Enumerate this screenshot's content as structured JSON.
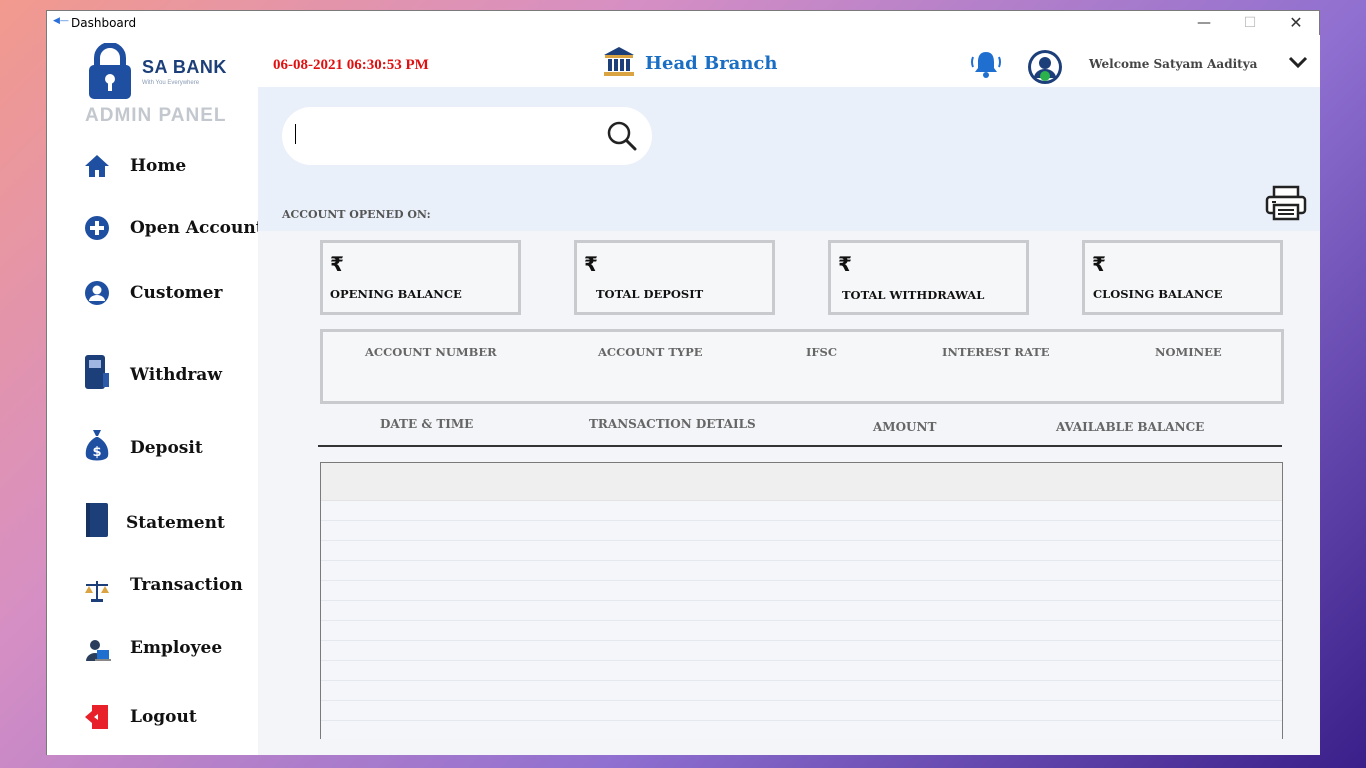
{
  "window": {
    "title": "Dashboard"
  },
  "sidebar": {
    "brand": "SA BANK",
    "tagline": "With You Everywhere",
    "panel_title": "ADMIN PANEL",
    "items": [
      {
        "label": "Home",
        "icon": "home-icon"
      },
      {
        "label": "Open Account",
        "icon": "plus-circle-icon"
      },
      {
        "label": "Customer",
        "icon": "user-circle-icon"
      },
      {
        "label": "Withdraw",
        "icon": "atm-icon"
      },
      {
        "label": "Deposit",
        "icon": "money-bag-icon"
      },
      {
        "label": "Statement",
        "icon": "notebook-icon"
      },
      {
        "label": "Transaction",
        "icon": "scale-icon"
      },
      {
        "label": "Employee",
        "icon": "employee-icon"
      },
      {
        "label": "Logout",
        "icon": "logout-icon"
      }
    ]
  },
  "header": {
    "datetime": "06-08-2021 06:30:53 PM",
    "branch": "Head Branch",
    "welcome": "Welcome Satyam Aaditya"
  },
  "main": {
    "search": {
      "value": "",
      "placeholder": ""
    },
    "account_opened_label": "ACCOUNT OPENED ON:",
    "cards": [
      {
        "symbol": "₹",
        "label": "OPENING BALANCE"
      },
      {
        "symbol": "₹",
        "label": "TOTAL DEPOSIT"
      },
      {
        "symbol": "₹",
        "label": "TOTAL WITHDRAWAL"
      },
      {
        "symbol": "₹",
        "label": "CLOSING BALANCE"
      }
    ],
    "account_info_headers": [
      "ACCOUNT NUMBER",
      "ACCOUNT TYPE",
      "IFSC",
      "INTEREST RATE",
      "NOMINEE"
    ],
    "transaction_headers": [
      "DATE & TIME",
      "TRANSACTION DETAILS",
      "AMOUNT",
      "AVAILABLE BALANCE"
    ]
  },
  "colors": {
    "accent_blue": "#1a6fc4",
    "datetime_red": "#e01010",
    "icon_blue": "#1f4fa0"
  }
}
